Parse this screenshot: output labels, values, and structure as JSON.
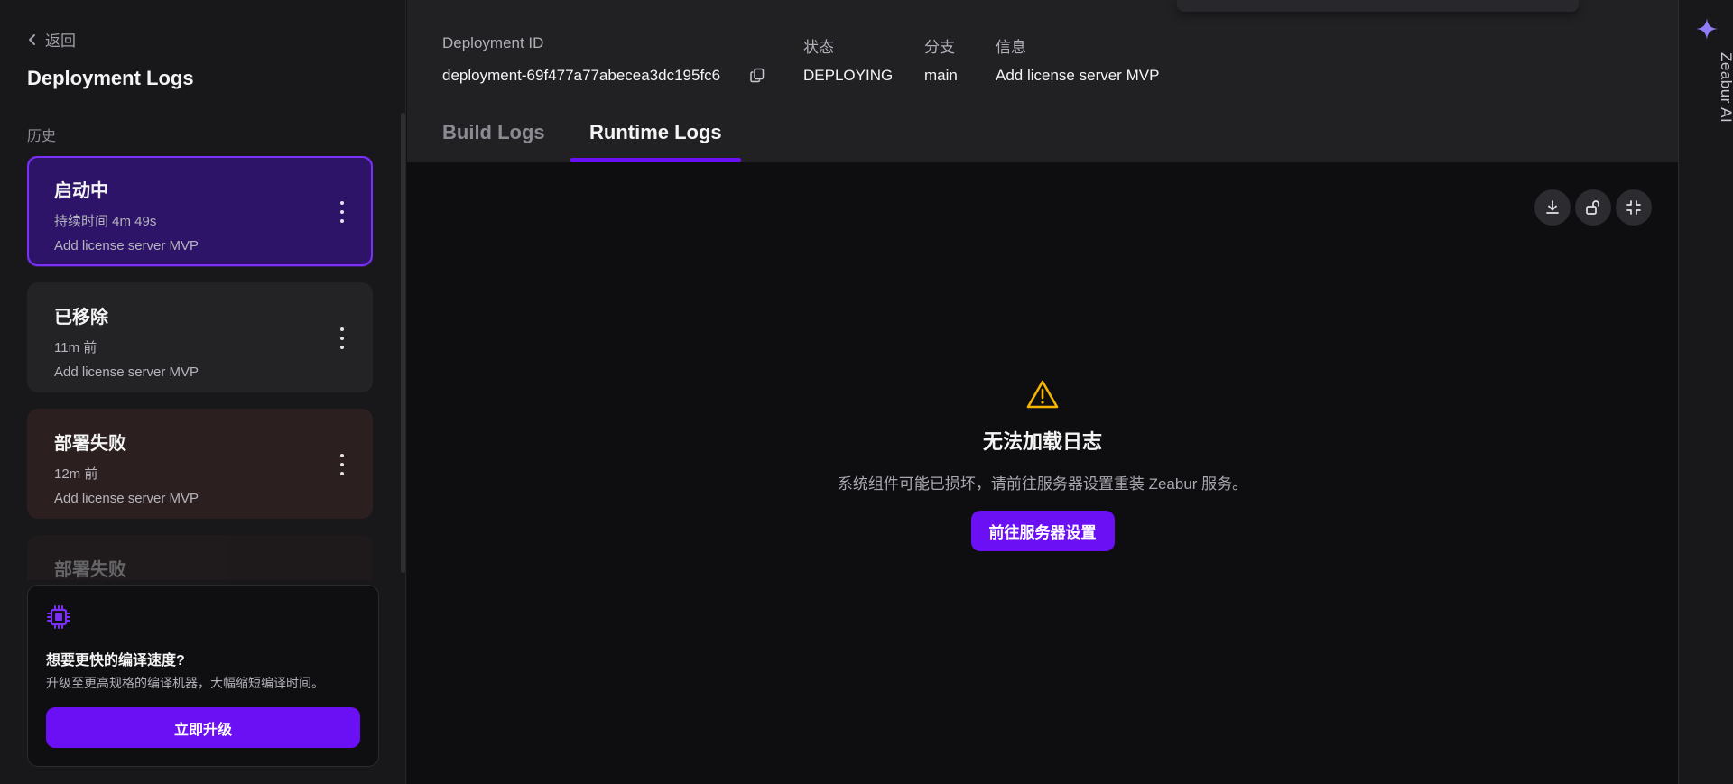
{
  "colors": {
    "accent": "#6b0ff5",
    "active_card_bg": "#2d1469",
    "failed_card_bg": "#2c1f1f",
    "warning": "#f5b400"
  },
  "sidebar": {
    "back_label": "返回",
    "title": "Deployment Logs",
    "section_label": "历史",
    "deployments": [
      {
        "status": "启动中",
        "time": "持续时间 4m 49s",
        "message": "Add license server MVP",
        "state": "active"
      },
      {
        "status": "已移除",
        "time": "11m 前",
        "message": "Add license server MVP",
        "state": "removed"
      },
      {
        "status": "部署失败",
        "time": "12m 前",
        "message": "Add license server MVP",
        "state": "failed"
      },
      {
        "status": "部署失败",
        "time": "",
        "message": "",
        "state": "failed"
      }
    ],
    "upgrade": {
      "icon": "cpu-chip-icon",
      "title": "想要更快的编译速度?",
      "description": "升级至更高规格的编译机器，大幅缩短编译时间。",
      "button_label": "立即升级"
    }
  },
  "header": {
    "deployment_id_label": "Deployment ID",
    "deployment_id": "deployment-69f477a77abecea3dc195fc6",
    "status_label": "状态",
    "status": "DEPLOYING",
    "branch_label": "分支",
    "branch": "main",
    "info_label": "信息",
    "info": "Add license server MVP"
  },
  "tabs": [
    {
      "label": "Build Logs",
      "active": false
    },
    {
      "label": "Runtime Logs",
      "active": true
    }
  ],
  "log_toolbar": [
    "download-icon",
    "unlock-icon",
    "collapse-icon"
  ],
  "empty_state": {
    "icon": "warning-triangle-icon",
    "title": "无法加载日志",
    "description": "系统组件可能已损坏，请前往服务器设置重装 Zeabur 服务。",
    "button_label": "前往服务器设置"
  },
  "ai_panel": {
    "icon": "sparkle-icon",
    "label": "Zeabur AI"
  }
}
